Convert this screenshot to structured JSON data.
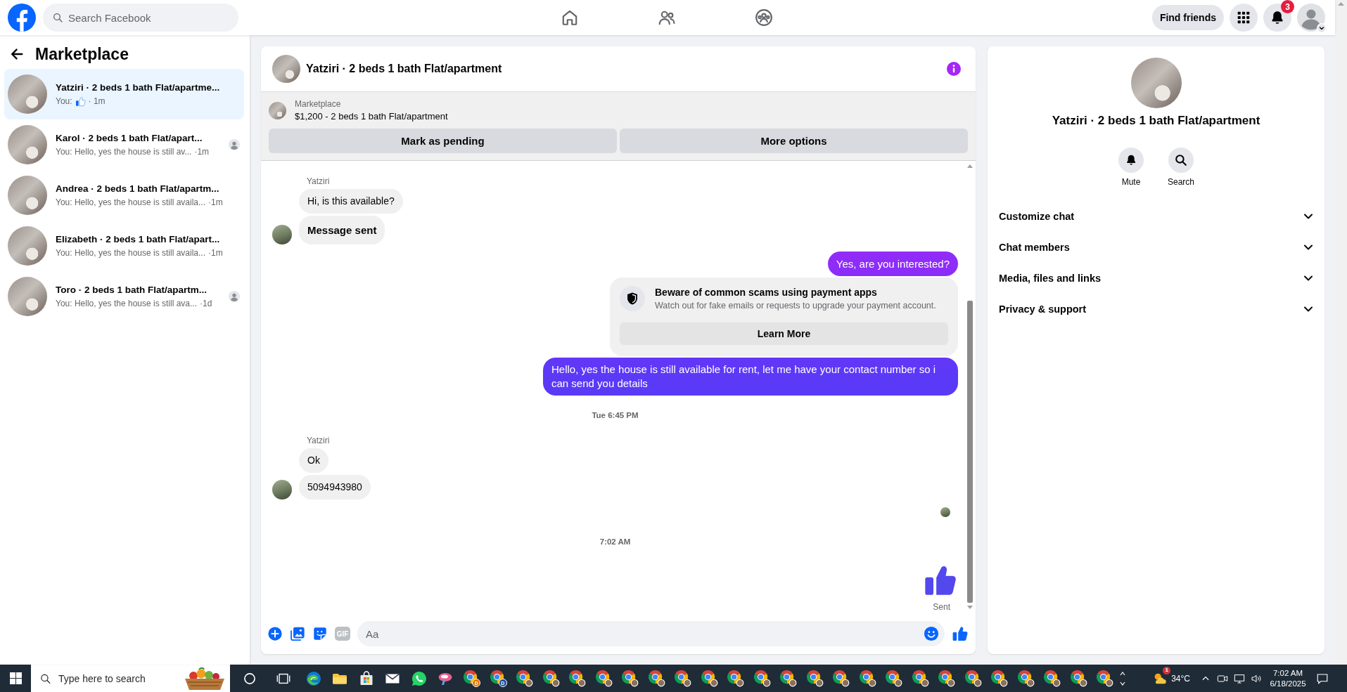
{
  "header": {
    "search": {
      "placeholder": "Search Facebook"
    },
    "nav_tabs": [
      {
        "kind": "home",
        "selected": false
      },
      {
        "kind": "friends",
        "selected": false
      },
      {
        "kind": "groups",
        "selected": false
      }
    ],
    "find_friends": "Find friends",
    "notifications": {
      "badge": "3"
    }
  },
  "sidebar": {
    "title": "Marketplace",
    "conversations": [
      {
        "kind": "like",
        "title": "Yatziri · 2 beds 1 bath Flat/apartme...",
        "snippet": "You:",
        "time": "· 1m",
        "selected": true,
        "seen": false
      },
      {
        "kind": "text",
        "title": "Karol · 2 beds 1 bath Flat/apart...",
        "snippet": "You: Hello, yes the house is still av...",
        "time": "·1m",
        "selected": false,
        "seen": true
      },
      {
        "kind": "text",
        "title": "Andrea · 2 beds 1 bath Flat/apartm...",
        "snippet": "You: Hello, yes the house is still availa...",
        "time": "·1m",
        "selected": false,
        "seen": false
      },
      {
        "kind": "text",
        "title": "Elizabeth · 2 beds 1 bath Flat/apart...",
        "snippet": "You: Hello, yes the house is still availa...",
        "time": "·1m",
        "selected": false,
        "seen": false
      },
      {
        "kind": "text",
        "title": "Toro · 2 beds 1 bath Flat/apartm...",
        "snippet": "You: Hello, yes the house is still ava...",
        "time": "·1d",
        "selected": false,
        "seen": true
      }
    ]
  },
  "chat": {
    "title": "Yatziri · 2 beds 1 bath Flat/apartment",
    "listing": {
      "label": "Marketplace",
      "summary": "$1,200 - 2 beds 1 bath Flat/apartment",
      "actions": [
        "Mark as pending",
        "More options"
      ]
    },
    "messages": [
      {
        "kind": "incoming",
        "sender": "Yatziri",
        "bubbles": [
          {
            "text": "Hi, is this available?",
            "bold": false
          },
          {
            "text": "Message sent",
            "bold": true
          }
        ]
      },
      {
        "kind": "outgoing",
        "text": "Yes, are you interested?"
      },
      {
        "kind": "notice",
        "title": "Beware of common scams using payment apps",
        "text": "Watch out for fake emails or requests to upgrade your payment account.",
        "button": "Learn More"
      },
      {
        "kind": "outgoing",
        "text": "Hello, yes the house is still available for rent, let me have your contact number so i can send you details"
      },
      {
        "kind": "timestamp",
        "text": "Tue 6:45 PM"
      },
      {
        "kind": "incoming",
        "sender": "Yatziri",
        "bubbles": [
          {
            "text": "Ok",
            "bold": false
          },
          {
            "text": "5094943980",
            "bold": false
          }
        ]
      },
      {
        "kind": "seen"
      },
      {
        "kind": "timestamp",
        "text": "7:02 AM"
      },
      {
        "kind": "like",
        "status": "Sent"
      }
    ],
    "composer": {
      "tools": [
        {
          "kind": "plus"
        },
        {
          "kind": "photo"
        },
        {
          "kind": "sticker"
        },
        {
          "kind": "gif",
          "label": "GIF"
        }
      ],
      "placeholder": "Aa"
    }
  },
  "details": {
    "title": "Yatziri · 2 beds 1 bath Flat/apartment",
    "actions": [
      {
        "kind": "mute",
        "label": "Mute"
      },
      {
        "kind": "search",
        "label": "Search"
      }
    ],
    "sections": [
      {
        "label": "Customize chat",
        "expanded": false
      },
      {
        "label": "Chat members",
        "expanded": false
      },
      {
        "label": "Media, files and links",
        "expanded": false
      },
      {
        "label": "Privacy & support",
        "expanded": false
      }
    ]
  },
  "taskbar": {
    "search": {
      "placeholder": "Type here to search"
    },
    "apps": [
      {
        "kind": "cortana"
      },
      {
        "kind": "task_view"
      },
      {
        "kind": "edge"
      },
      {
        "kind": "files"
      },
      {
        "kind": "store"
      },
      {
        "kind": "mail"
      },
      {
        "kind": "whatsapp"
      },
      {
        "kind": "paint"
      },
      {
        "kind": "chrome",
        "badge": "D",
        "color": "#e37400"
      },
      {
        "kind": "chrome",
        "badge": "D",
        "color": "#1a4fa8"
      },
      {
        "kind": "chrome"
      },
      {
        "kind": "chrome"
      },
      {
        "kind": "chrome"
      },
      {
        "kind": "chrome"
      },
      {
        "kind": "chrome"
      },
      {
        "kind": "chrome"
      },
      {
        "kind": "chrome"
      },
      {
        "kind": "chrome"
      },
      {
        "kind": "chrome"
      },
      {
        "kind": "chrome"
      },
      {
        "kind": "chrome"
      },
      {
        "kind": "chrome"
      },
      {
        "kind": "chrome"
      },
      {
        "kind": "chrome"
      },
      {
        "kind": "chrome"
      },
      {
        "kind": "chrome"
      },
      {
        "kind": "chrome"
      },
      {
        "kind": "chrome"
      },
      {
        "kind": "chrome"
      },
      {
        "kind": "chrome"
      },
      {
        "kind": "chrome"
      },
      {
        "kind": "chrome"
      },
      {
        "kind": "chrome"
      }
    ],
    "weather": {
      "badge": "1",
      "temperature": "34°C"
    },
    "clock": {
      "time": "7:02 AM",
      "date": "6/18/2025"
    }
  }
}
